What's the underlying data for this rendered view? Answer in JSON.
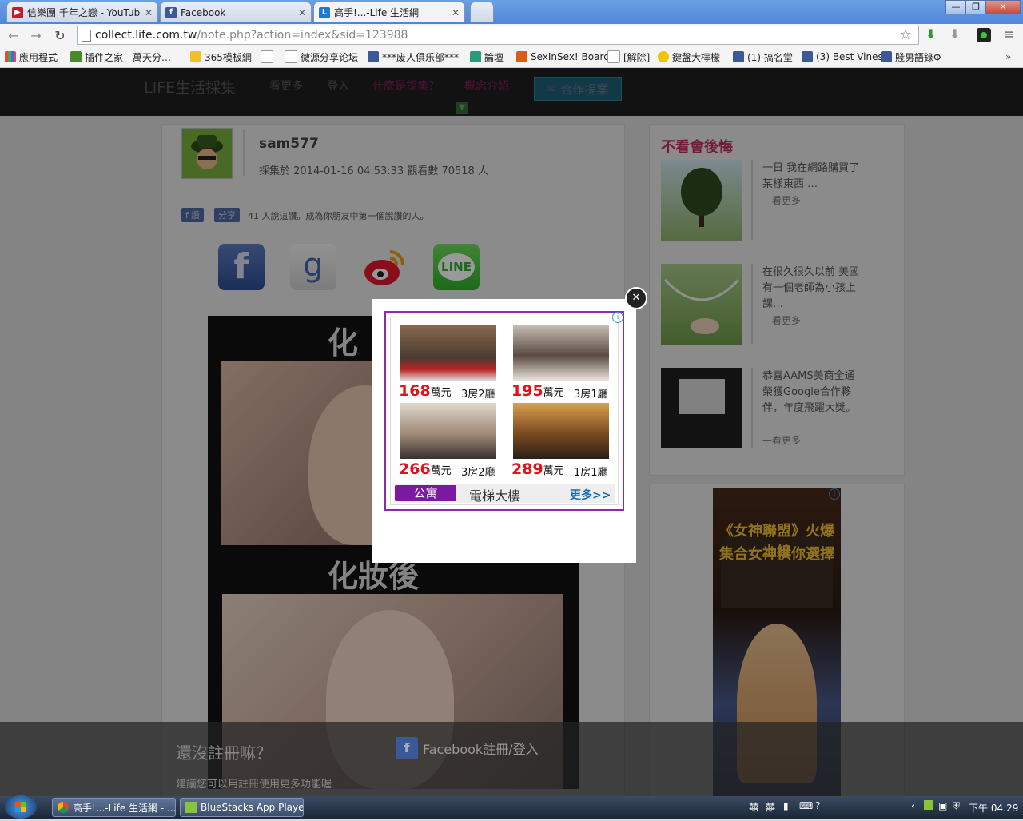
{
  "browser": {
    "tabs": [
      {
        "title": "信樂團 千年之戀 - YouTube",
        "favicon_color": "#cc181e"
      },
      {
        "title": "Facebook",
        "favicon_color": "#3b5998"
      },
      {
        "title": "高手!...-Life 生活網",
        "favicon_color": "#1a7bd6"
      }
    ],
    "url_host": "collect.life.com.tw",
    "url_path": "/note.php?action=index&sid=123988",
    "bookmarks": [
      "應用程式",
      "插件之家 - 萬天分…",
      "365模板網",
      "",
      "微源分享论坛",
      "***废人俱乐部***",
      "論壇",
      "SexInSex! Board",
      "[解除]",
      "鍵盤大檸檬",
      "(1) 搞名堂",
      "(3) Best Vines",
      "賤男語錄Φ"
    ],
    "window_controls": [
      "—",
      "❐",
      "✕"
    ]
  },
  "site": {
    "logo": "LIFE生活採集",
    "nav": [
      "看更多",
      "登入",
      "什麼是採集？",
      "概念介紹"
    ],
    "cta_label": "合作提案"
  },
  "post": {
    "username": "sam577",
    "meta": "採集於 2014-01-16 04:53:33 觀看數 70518 人",
    "like_label": "讚",
    "share_label": "分享",
    "like_text": "41 人說這讚。成為你朋友中第一個說讚的人。",
    "img_caption_top": "化",
    "img_caption_bottom": "化妝後"
  },
  "sidebar": {
    "title": "不看會後悔",
    "items": [
      {
        "text": "一日 我在網路購買了某樣東西 …",
        "more": "—看更多"
      },
      {
        "text": "在很久很久以前 美國有一個老師為小孩上課…",
        "more": "—看更多"
      },
      {
        "text": "恭喜AAMS美商全通榮獲Google合作夥伴，年度飛躍大獎。",
        "more": "—看更多"
      }
    ],
    "ad_line1": "《女神聯盟》火爆上線",
    "ad_line2": "集合女神供你選擇"
  },
  "modal": {
    "close_label": "✕",
    "ad": {
      "listings": [
        {
          "price": "168",
          "unit": "萬元",
          "rooms": "3房2廳"
        },
        {
          "price": "195",
          "unit": "萬元",
          "rooms": "3房1廳"
        },
        {
          "price": "266",
          "unit": "萬元",
          "rooms": "3房2廳"
        },
        {
          "price": "289",
          "unit": "萬元",
          "rooms": "1房1廳"
        }
      ],
      "tab_active": "公寓",
      "tab_other": "電梯大樓",
      "more": "更多>>"
    }
  },
  "signup_bar": {
    "title": "還沒註冊嘛？",
    "fb_label": "Facebook註冊/登入",
    "hint": "建議您可以用註冊使用更多功能喔"
  },
  "taskbar": {
    "items": [
      "高手!...-Life 生活網 - ...",
      "BlueStacks App Player ..."
    ],
    "clock": "下午 04:29"
  }
}
